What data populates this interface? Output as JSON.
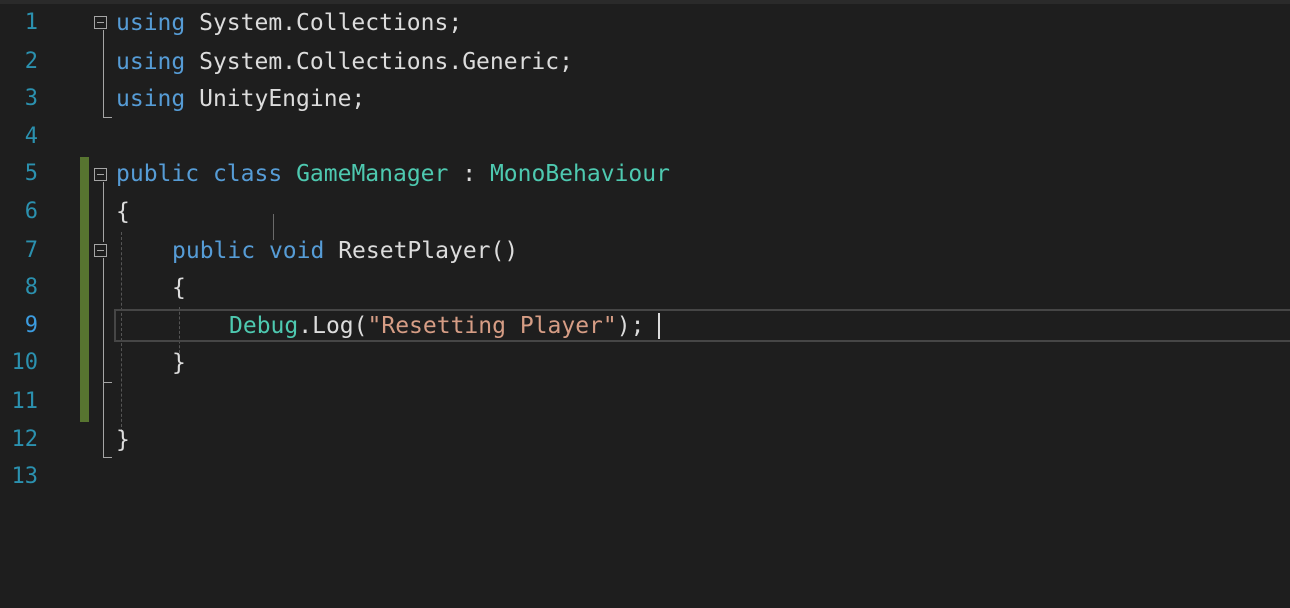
{
  "editor": {
    "line_numbers": [
      "1",
      "2",
      "3",
      "4",
      "5",
      "6",
      "7",
      "8",
      "9",
      "10",
      "11",
      "12",
      "13"
    ],
    "lines": {
      "l1": {
        "kw": "using",
        "rest": " System.Collections;"
      },
      "l2": {
        "kw": "using",
        "rest": " System.Collections.Generic;"
      },
      "l3": {
        "kw": "using",
        "rest": " UnityEngine;"
      },
      "l5": {
        "kw1": "public",
        "kw2": "class",
        "name": "GameManager",
        "colon": " : ",
        "base": "MonoBehaviour"
      },
      "l6": {
        "text": "{"
      },
      "l7": {
        "kw1": "public",
        "kw2": "void",
        "rest": " ResetPlayer()"
      },
      "l8": {
        "text": "{"
      },
      "l9": {
        "type": "Debug",
        "call": ".Log(",
        "str": "\"Resetting Player\"",
        "end": ");"
      },
      "l10": {
        "text": "}"
      },
      "l12": {
        "text": "}"
      }
    },
    "current_line": "9"
  },
  "colors": {
    "background": "#1e1e1e",
    "keyword": "#569cd6",
    "type": "#4ec9b0",
    "string": "#d69d85",
    "line_number": "#2b91af",
    "change_marker": "#577430"
  }
}
